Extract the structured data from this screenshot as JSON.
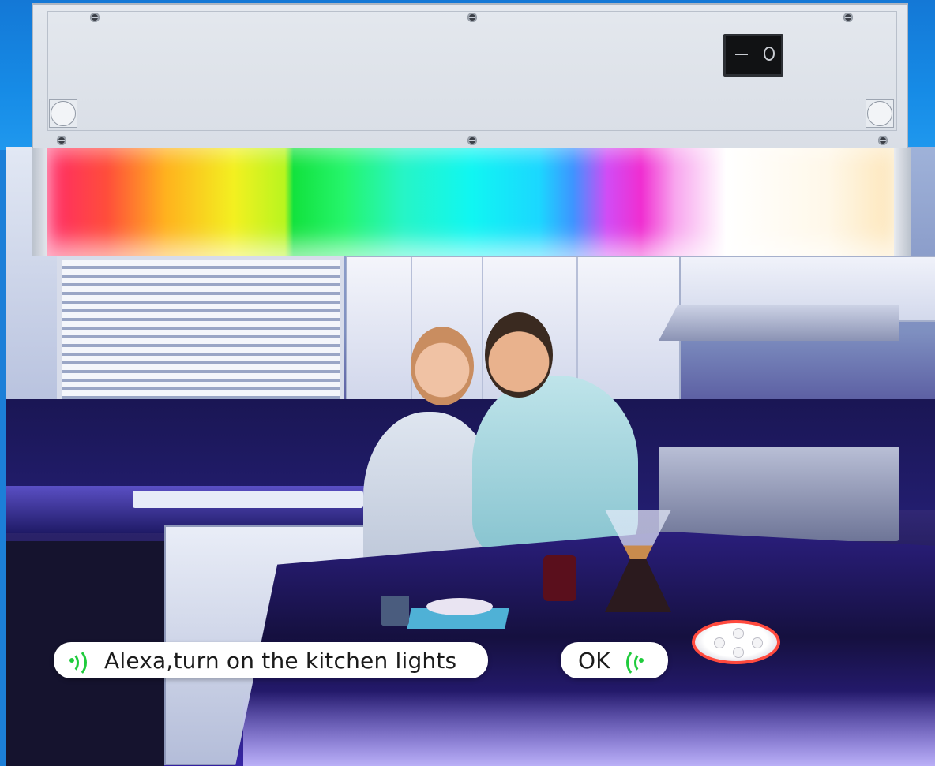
{
  "product": {
    "switch": {
      "on_symbol": "—",
      "off_symbol": "O"
    }
  },
  "voice_dialog": {
    "command": "Alexa,turn on the kitchen lights",
    "reply": "OK"
  },
  "icons": {
    "voice_out": "voice-waves-icon",
    "voice_in": "voice-waves-icon",
    "speaker": "smart-speaker-icon"
  },
  "colors": {
    "background_blue": "#1c7fd8",
    "wave_green": "#1fcb3c",
    "speaker_ring": "#ff4a3e"
  }
}
